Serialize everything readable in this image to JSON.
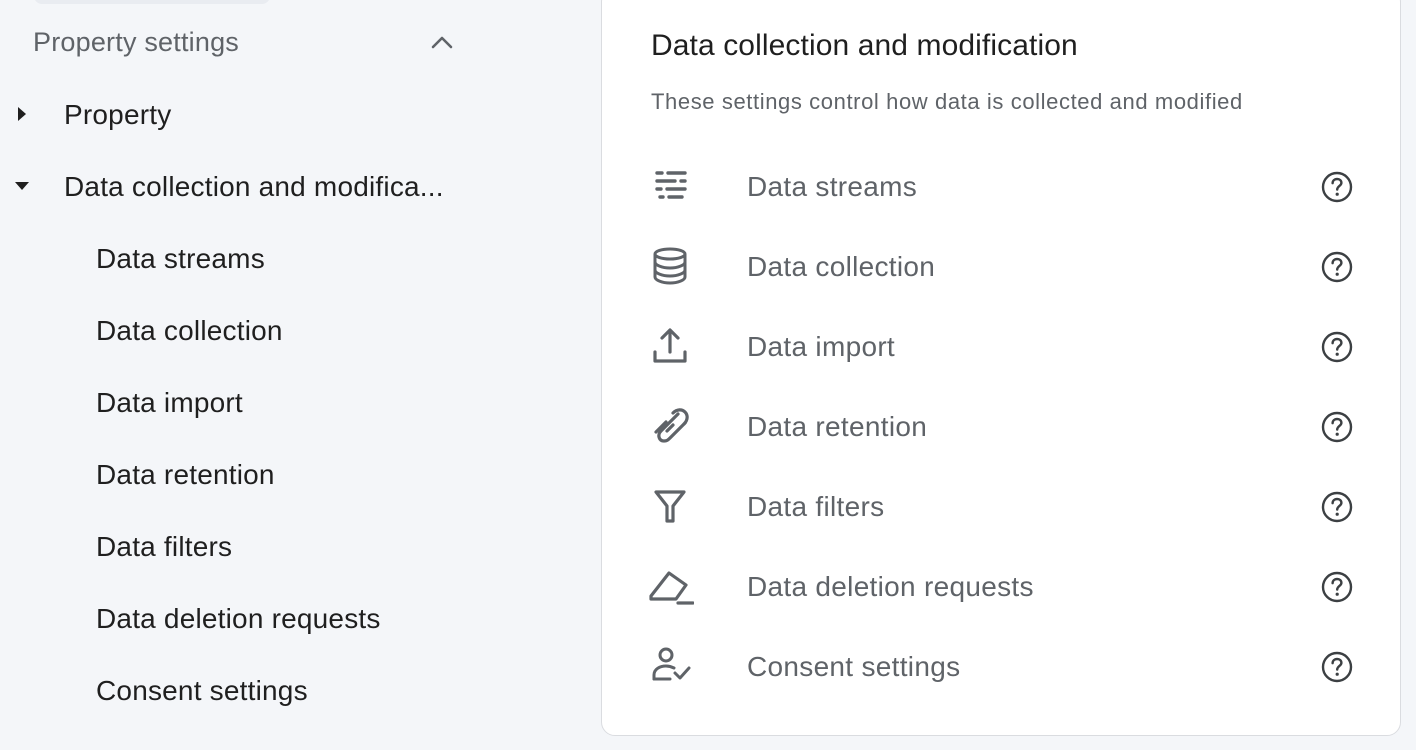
{
  "sidebar": {
    "section_title": "Property settings",
    "items": [
      {
        "label": "Property",
        "expanded": false
      },
      {
        "label": "Data collection and modifica...",
        "expanded": true
      }
    ],
    "children": [
      {
        "label": "Data streams"
      },
      {
        "label": "Data collection"
      },
      {
        "label": "Data import"
      },
      {
        "label": "Data retention"
      },
      {
        "label": "Data filters"
      },
      {
        "label": "Data deletion requests"
      },
      {
        "label": "Consent settings"
      }
    ]
  },
  "card": {
    "title": "Data collection and modification",
    "subtitle": "These settings control how data is collected and modified",
    "rows": [
      {
        "label": "Data streams",
        "icon": "data-streams-icon"
      },
      {
        "label": "Data collection",
        "icon": "database-icon"
      },
      {
        "label": "Data import",
        "icon": "upload-icon"
      },
      {
        "label": "Data retention",
        "icon": "attachment-icon"
      },
      {
        "label": "Data filters",
        "icon": "filter-icon"
      },
      {
        "label": "Data deletion requests",
        "icon": "eraser-icon"
      },
      {
        "label": "Consent settings",
        "icon": "person-check-icon"
      }
    ],
    "help_icon": "help-circle-icon"
  },
  "colors": {
    "background": "#f4f6f9",
    "card": "#ffffff",
    "primary_text": "#1f1f1f",
    "secondary_text": "#5f6368",
    "icon": "#5f6368",
    "border": "#dadce0"
  }
}
